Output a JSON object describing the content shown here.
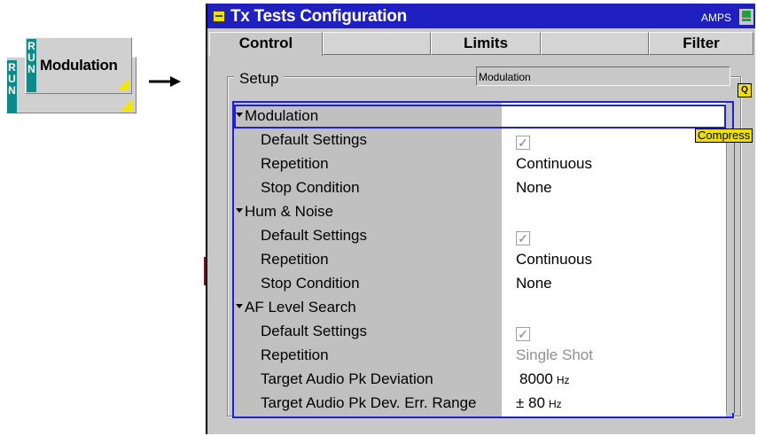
{
  "softkey": {
    "run_letters": [
      "R",
      "U",
      "N"
    ],
    "label": "Modulation"
  },
  "window": {
    "title": "Tx Tests Configuration",
    "standard": "AMPS"
  },
  "tabs": [
    {
      "label": "Control",
      "active": true
    },
    {
      "label": "",
      "active": false
    },
    {
      "label": "Limits",
      "active": false
    },
    {
      "label": "",
      "active": false
    },
    {
      "label": "Filter",
      "active": false
    }
  ],
  "setup": {
    "legend": "Setup",
    "field_value": "Modulation",
    "q_marker": "Q",
    "compress_label": "Compress"
  },
  "tree": {
    "rows": [
      {
        "label": "Modulation",
        "level": 0,
        "value": "",
        "type": "group"
      },
      {
        "label": "Default Settings",
        "level": 1,
        "value": "✓",
        "type": "checkbox"
      },
      {
        "label": "Repetition",
        "level": 1,
        "value": "Continuous",
        "type": "text"
      },
      {
        "label": "Stop Condition",
        "level": 1,
        "value": "None",
        "type": "text"
      },
      {
        "label": "Hum & Noise",
        "level": 0,
        "value": "",
        "type": "group"
      },
      {
        "label": "Default Settings",
        "level": 1,
        "value": "✓",
        "type": "checkbox"
      },
      {
        "label": "Repetition",
        "level": 1,
        "value": "Continuous",
        "type": "text"
      },
      {
        "label": "Stop Condition",
        "level": 1,
        "value": "None",
        "type": "text"
      },
      {
        "label": "AF Level Search",
        "level": 0,
        "value": "",
        "type": "group"
      },
      {
        "label": "Default Settings",
        "level": 1,
        "value": "✓",
        "type": "checkbox"
      },
      {
        "label": "Repetition",
        "level": 1,
        "value": "Single Shot",
        "type": "text-disabled"
      },
      {
        "label": "Target Audio Pk Deviation",
        "level": 1,
        "value": "8000",
        "unit": "Hz",
        "type": "number"
      },
      {
        "label": "Target Audio Pk Dev. Err. Range",
        "level": 1,
        "value": "± 80",
        "unit": "Hz",
        "type": "number"
      }
    ]
  },
  "colors": {
    "title_bar": "#2020c0",
    "selection_border": "#2020d0",
    "badge_teal": "#0e8a8a",
    "marker_yellow": "#f0e000"
  }
}
